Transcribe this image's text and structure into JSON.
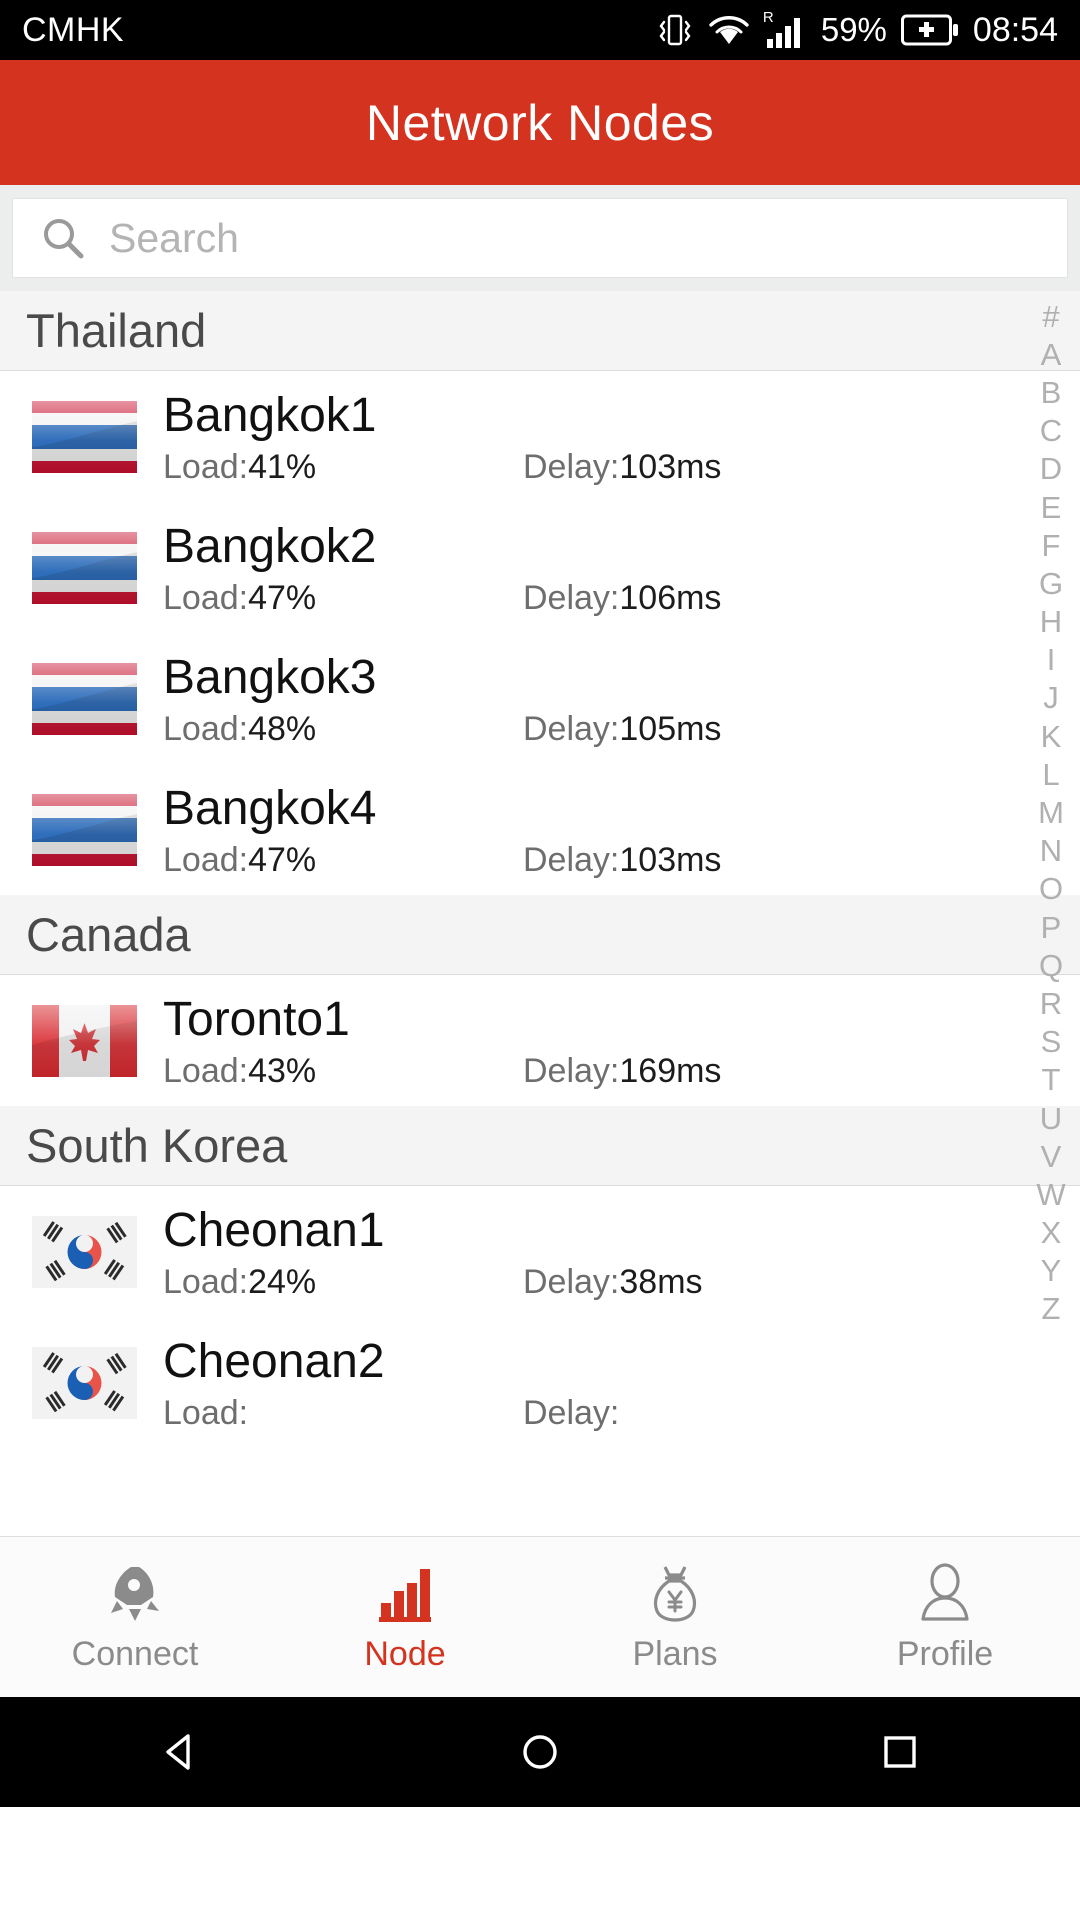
{
  "statusbar": {
    "carrier": "CMHK",
    "battery_percent": "59%",
    "clock": "08:54",
    "icons": [
      "vibrate-icon",
      "wifi-icon",
      "cellular-signal-icon",
      "battery-icon"
    ],
    "roaming_label": "R"
  },
  "appbar": {
    "title": "Network Nodes"
  },
  "search": {
    "placeholder": "Search",
    "value": ""
  },
  "sections": [
    {
      "country": "Thailand",
      "flag": "thailand-flag",
      "nodes": [
        {
          "name": "Bangkok1",
          "load_label": "Load:",
          "load_value": "41%",
          "delay_label": "Delay:",
          "delay_value": "103ms"
        },
        {
          "name": "Bangkok2",
          "load_label": "Load:",
          "load_value": "47%",
          "delay_label": "Delay:",
          "delay_value": "106ms"
        },
        {
          "name": "Bangkok3",
          "load_label": "Load:",
          "load_value": "48%",
          "delay_label": "Delay:",
          "delay_value": "105ms"
        },
        {
          "name": "Bangkok4",
          "load_label": "Load:",
          "load_value": "47%",
          "delay_label": "Delay:",
          "delay_value": "103ms"
        }
      ]
    },
    {
      "country": "Canada",
      "flag": "canada-flag",
      "nodes": [
        {
          "name": "Toronto1",
          "load_label": "Load:",
          "load_value": "43%",
          "delay_label": "Delay:",
          "delay_value": "169ms"
        }
      ]
    },
    {
      "country": "South Korea",
      "flag": "south-korea-flag",
      "nodes": [
        {
          "name": "Cheonan1",
          "load_label": "Load:",
          "load_value": "24%",
          "delay_label": "Delay:",
          "delay_value": "38ms"
        },
        {
          "name": "Cheonan2",
          "load_label": "Load:",
          "load_value": "",
          "delay_label": "Delay:",
          "delay_value": ""
        }
      ]
    }
  ],
  "alpha_index": [
    "#",
    "A",
    "B",
    "C",
    "D",
    "E",
    "F",
    "G",
    "H",
    "I",
    "J",
    "K",
    "L",
    "M",
    "N",
    "O",
    "P",
    "Q",
    "R",
    "S",
    "T",
    "U",
    "V",
    "W",
    "X",
    "Y",
    "Z"
  ],
  "tabbar": {
    "tabs": [
      {
        "label": "Connect",
        "icon": "rocket-icon",
        "active": false
      },
      {
        "label": "Node",
        "icon": "bar-chart-icon",
        "active": true
      },
      {
        "label": "Plans",
        "icon": "money-bag-icon",
        "active": false
      },
      {
        "label": "Profile",
        "icon": "person-icon",
        "active": false
      }
    ]
  },
  "navbar": {
    "buttons": [
      {
        "icon": "back-triangle-icon"
      },
      {
        "icon": "home-circle-icon"
      },
      {
        "icon": "recents-square-icon"
      }
    ]
  },
  "colors": {
    "accent": "#d3331f",
    "header_bg": "#d3331f",
    "section_bg": "#f4f4f4",
    "page_bg": "#ffffff",
    "muted_text": "#6e6e6e"
  }
}
